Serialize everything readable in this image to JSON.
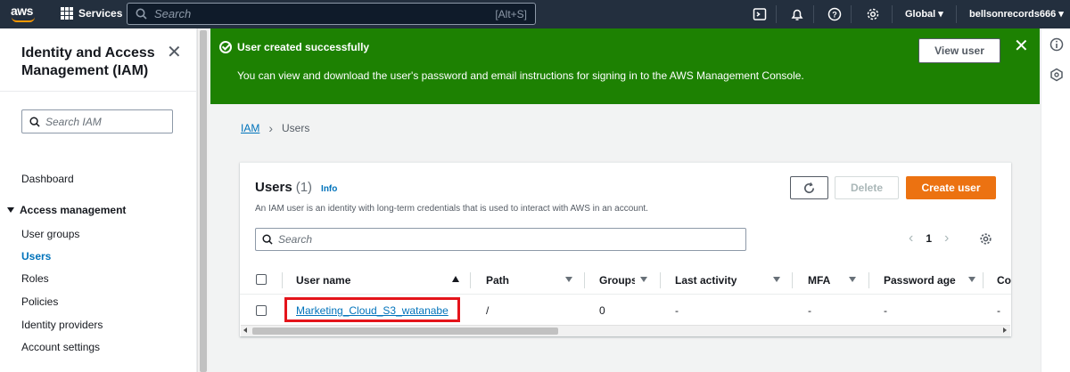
{
  "topnav": {
    "logo_text": "aws",
    "services_label": "Services",
    "search_placeholder": "Search",
    "search_shortcut": "[Alt+S]",
    "icons": [
      "cloudshell-icon",
      "notifications-icon",
      "help-icon",
      "settings-icon"
    ],
    "region_label": "Global",
    "account_label": "bellsonrecords666"
  },
  "sidebar": {
    "title": "Identity and Access Management (IAM)",
    "search_placeholder": "Search IAM",
    "dashboard_label": "Dashboard",
    "section_label": "Access management",
    "items": [
      {
        "label": "User groups",
        "active": false
      },
      {
        "label": "Users",
        "active": true
      },
      {
        "label": "Roles",
        "active": false
      },
      {
        "label": "Policies",
        "active": false
      },
      {
        "label": "Identity providers",
        "active": false
      },
      {
        "label": "Account settings",
        "active": false
      }
    ]
  },
  "flash": {
    "title": "User created successfully",
    "message": "You can view and download the user's password and email instructions for signing in to the AWS Management Console.",
    "view_user_label": "View user",
    "color": "#1d8102"
  },
  "breadcrumb": {
    "root": "IAM",
    "current": "Users"
  },
  "users_panel": {
    "title": "Users",
    "count": "(1)",
    "info_label": "Info",
    "description": "An IAM user is an identity with long-term credentials that is used to interact with AWS in an account.",
    "delete_label": "Delete",
    "create_label": "Create user",
    "search_placeholder": "Search",
    "page_number": "1",
    "columns": [
      "User name",
      "Path",
      "Groups",
      "Last activity",
      "MFA",
      "Password age",
      "Co"
    ],
    "rows": [
      {
        "user_name": "Marketing_Cloud_S3_watanabe",
        "path": "/",
        "groups": "0",
        "last_activity": "-",
        "mfa": "-",
        "password_age": "-",
        "console": "-"
      }
    ]
  },
  "colors": {
    "nav_bg": "#232f3e",
    "accent_orange": "#ec7211",
    "link_blue": "#0073bb",
    "highlight_red": "#e4141b"
  }
}
